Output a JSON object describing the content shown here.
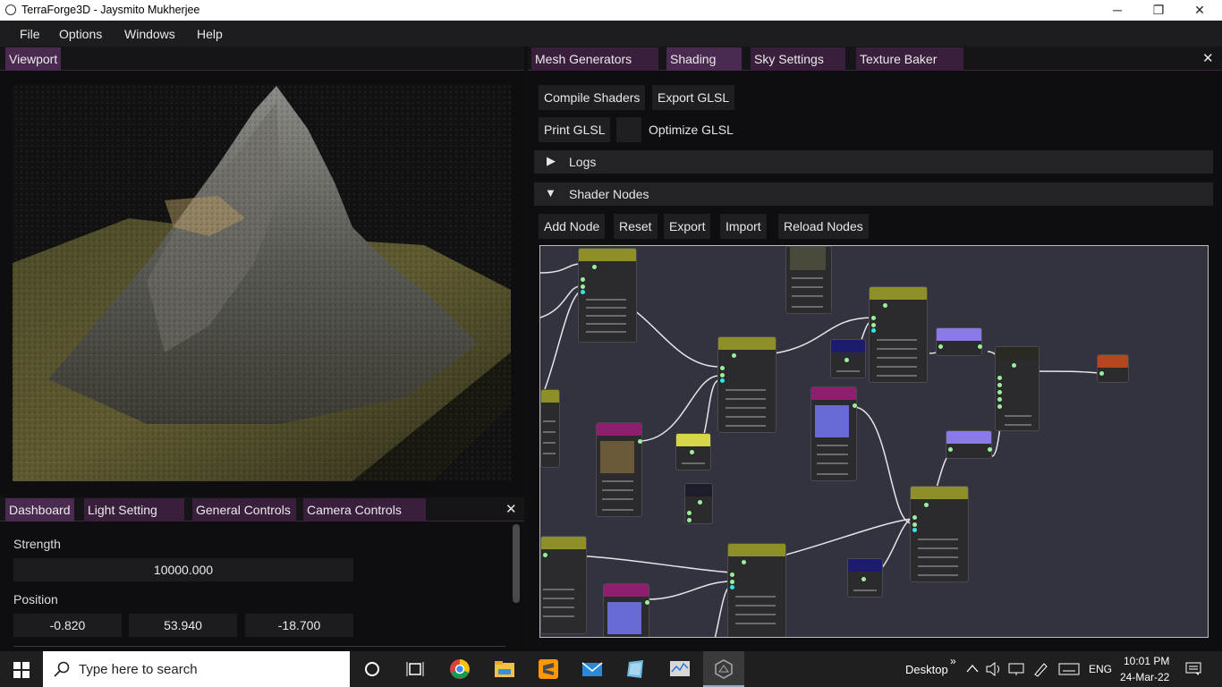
{
  "window": {
    "title": "TerraForge3D - Jaysmito Mukherjee",
    "minimize": "─",
    "restore": "❐",
    "close": "✕"
  },
  "menu": [
    "File",
    "Options",
    "Windows",
    "Help"
  ],
  "viewport": {
    "tab": "Viewport"
  },
  "controls": {
    "tabs": [
      "Dashboard",
      "Light Setting",
      "General Controls",
      "Camera Controls"
    ],
    "close": "✕",
    "strength_label": "Strength",
    "strength_value": "10000.000",
    "position_label": "Position",
    "position_values": [
      "-0.820",
      "53.940",
      "-18.700"
    ]
  },
  "right": {
    "tabs": [
      "Mesh Generators",
      "Shading",
      "Sky Settings",
      "Texture Baker"
    ],
    "close": "✕",
    "compile": "Compile Shaders",
    "export_glsl": "Export GLSL",
    "print_glsl": "Print GLSL",
    "optimize_glsl": "Optimize GLSL",
    "logs_arrow": "▶",
    "logs": "Logs",
    "nodes_arrow": "▼",
    "shader_nodes": "Shader Nodes",
    "node_buttons": [
      "Add Node",
      "Reset",
      "Export",
      "Import",
      "Reload Nodes"
    ]
  },
  "taskbar": {
    "search_placeholder": "Type here to search",
    "desktop": "Desktop",
    "chevron": "»",
    "lang": "ENG",
    "time": "10:01 PM",
    "date": "24-Mar-22"
  },
  "colors": {
    "accent": "#3a1f3d",
    "node_olive": "#8f8f2a",
    "node_magenta": "#8e1f6e",
    "node_navy": "#1c1c6e",
    "node_lilac": "#8a7ae6",
    "node_yellow": "#d6d64a",
    "node_output": "#b5461f"
  }
}
